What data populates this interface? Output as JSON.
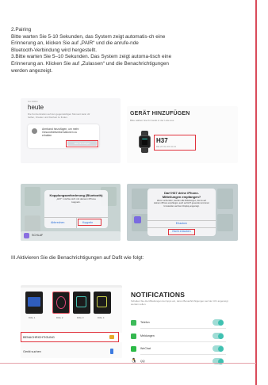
{
  "instructions": {
    "lines": [
      "2.Pairing",
      "Bitte warten Sie 5-10 Sekunden, das System zeigt automatis-ch eine",
      "Erinnerung an, klicken Sie auf „PAIR“ und die anrufe-nde",
      "Bluetooth-Verbindung wird hergestellt.",
      "3.Bitte warten Sie 5–10 Sekunden. Das System zeigt automa-tisch eine",
      "Erinnerung an. Klicken Sie auf „Zulassen“ und die Benachrichtigungen",
      "werden angezeigt."
    ]
  },
  "panel_today": {
    "tag": "ios status",
    "title": "heute",
    "subtitle": "Die Konzentration auf den gegenwärtigen Moment kann dir helfen, Frieden und Klarheit zu finden.",
    "card_text": "Armband hinzufügen, um mehr Gesundheitsinformationen zu erhalten",
    "card_button": "Jetzt hinzufügen"
  },
  "panel_add_device": {
    "title": "GERÄT HINZUFÜGEN",
    "subtitle": "Bitte wählen Sie Ihr Gerät in der Liste aus",
    "device_name": "H37",
    "device_mac": "DE:2F:6A:F0:4C:D"
  },
  "dialog_pairing": {
    "title": "Kopplungsanforderung (Bluetooth)",
    "body": "„H37“ möchte sich mit deinem iPhone koppeln.",
    "cancel": "Abbrechen",
    "pair": "Koppeln",
    "behind_label": "SCHLAF"
  },
  "dialog_notifications": {
    "title": "Darf H37 deine iPhone-Mitteilungen empfangen?",
    "body": "Wenn verbunden, werden alle Mitteilungen, die du auf deinem iPhone empfängst, auch auf H37 gesendet und einer Umstanden auf dem Display angezeigt.",
    "allow": "Erlauben",
    "deny": "Nicht erlauben"
  },
  "section3": {
    "heading": "III.Aktivieren Sie die Benachrichtigungen auf Dafit wie folgt:"
  },
  "panel_watch_settings": {
    "faces": [
      "DIAL 1",
      "DIAL 2",
      "DIAL 3",
      "DIAL 4"
    ],
    "notification_row": "BENACHRICHTIGUNG",
    "find_device_row": "Gerät suchen"
  },
  "panel_notifications": {
    "title": "NOTIFICATIONS",
    "description": "Schalten Sie die Mitteilungen der Apps ein, deren Benachrichtigungen auf der Uhr angezeigt werden sollen.",
    "apps": [
      {
        "name": "Telefon",
        "color": "#3dbb5a",
        "enabled": true
      },
      {
        "name": "Meldungen",
        "color": "#35b850",
        "enabled": true
      },
      {
        "name": "WeChat",
        "color": "#2dbb47",
        "enabled": true
      },
      {
        "name": "QQ",
        "color": "#222222",
        "enabled": true
      }
    ]
  },
  "colors": {
    "accent_red": "#e0323c",
    "teal": "#3fc1b1",
    "page_border": "#d94b5a"
  }
}
